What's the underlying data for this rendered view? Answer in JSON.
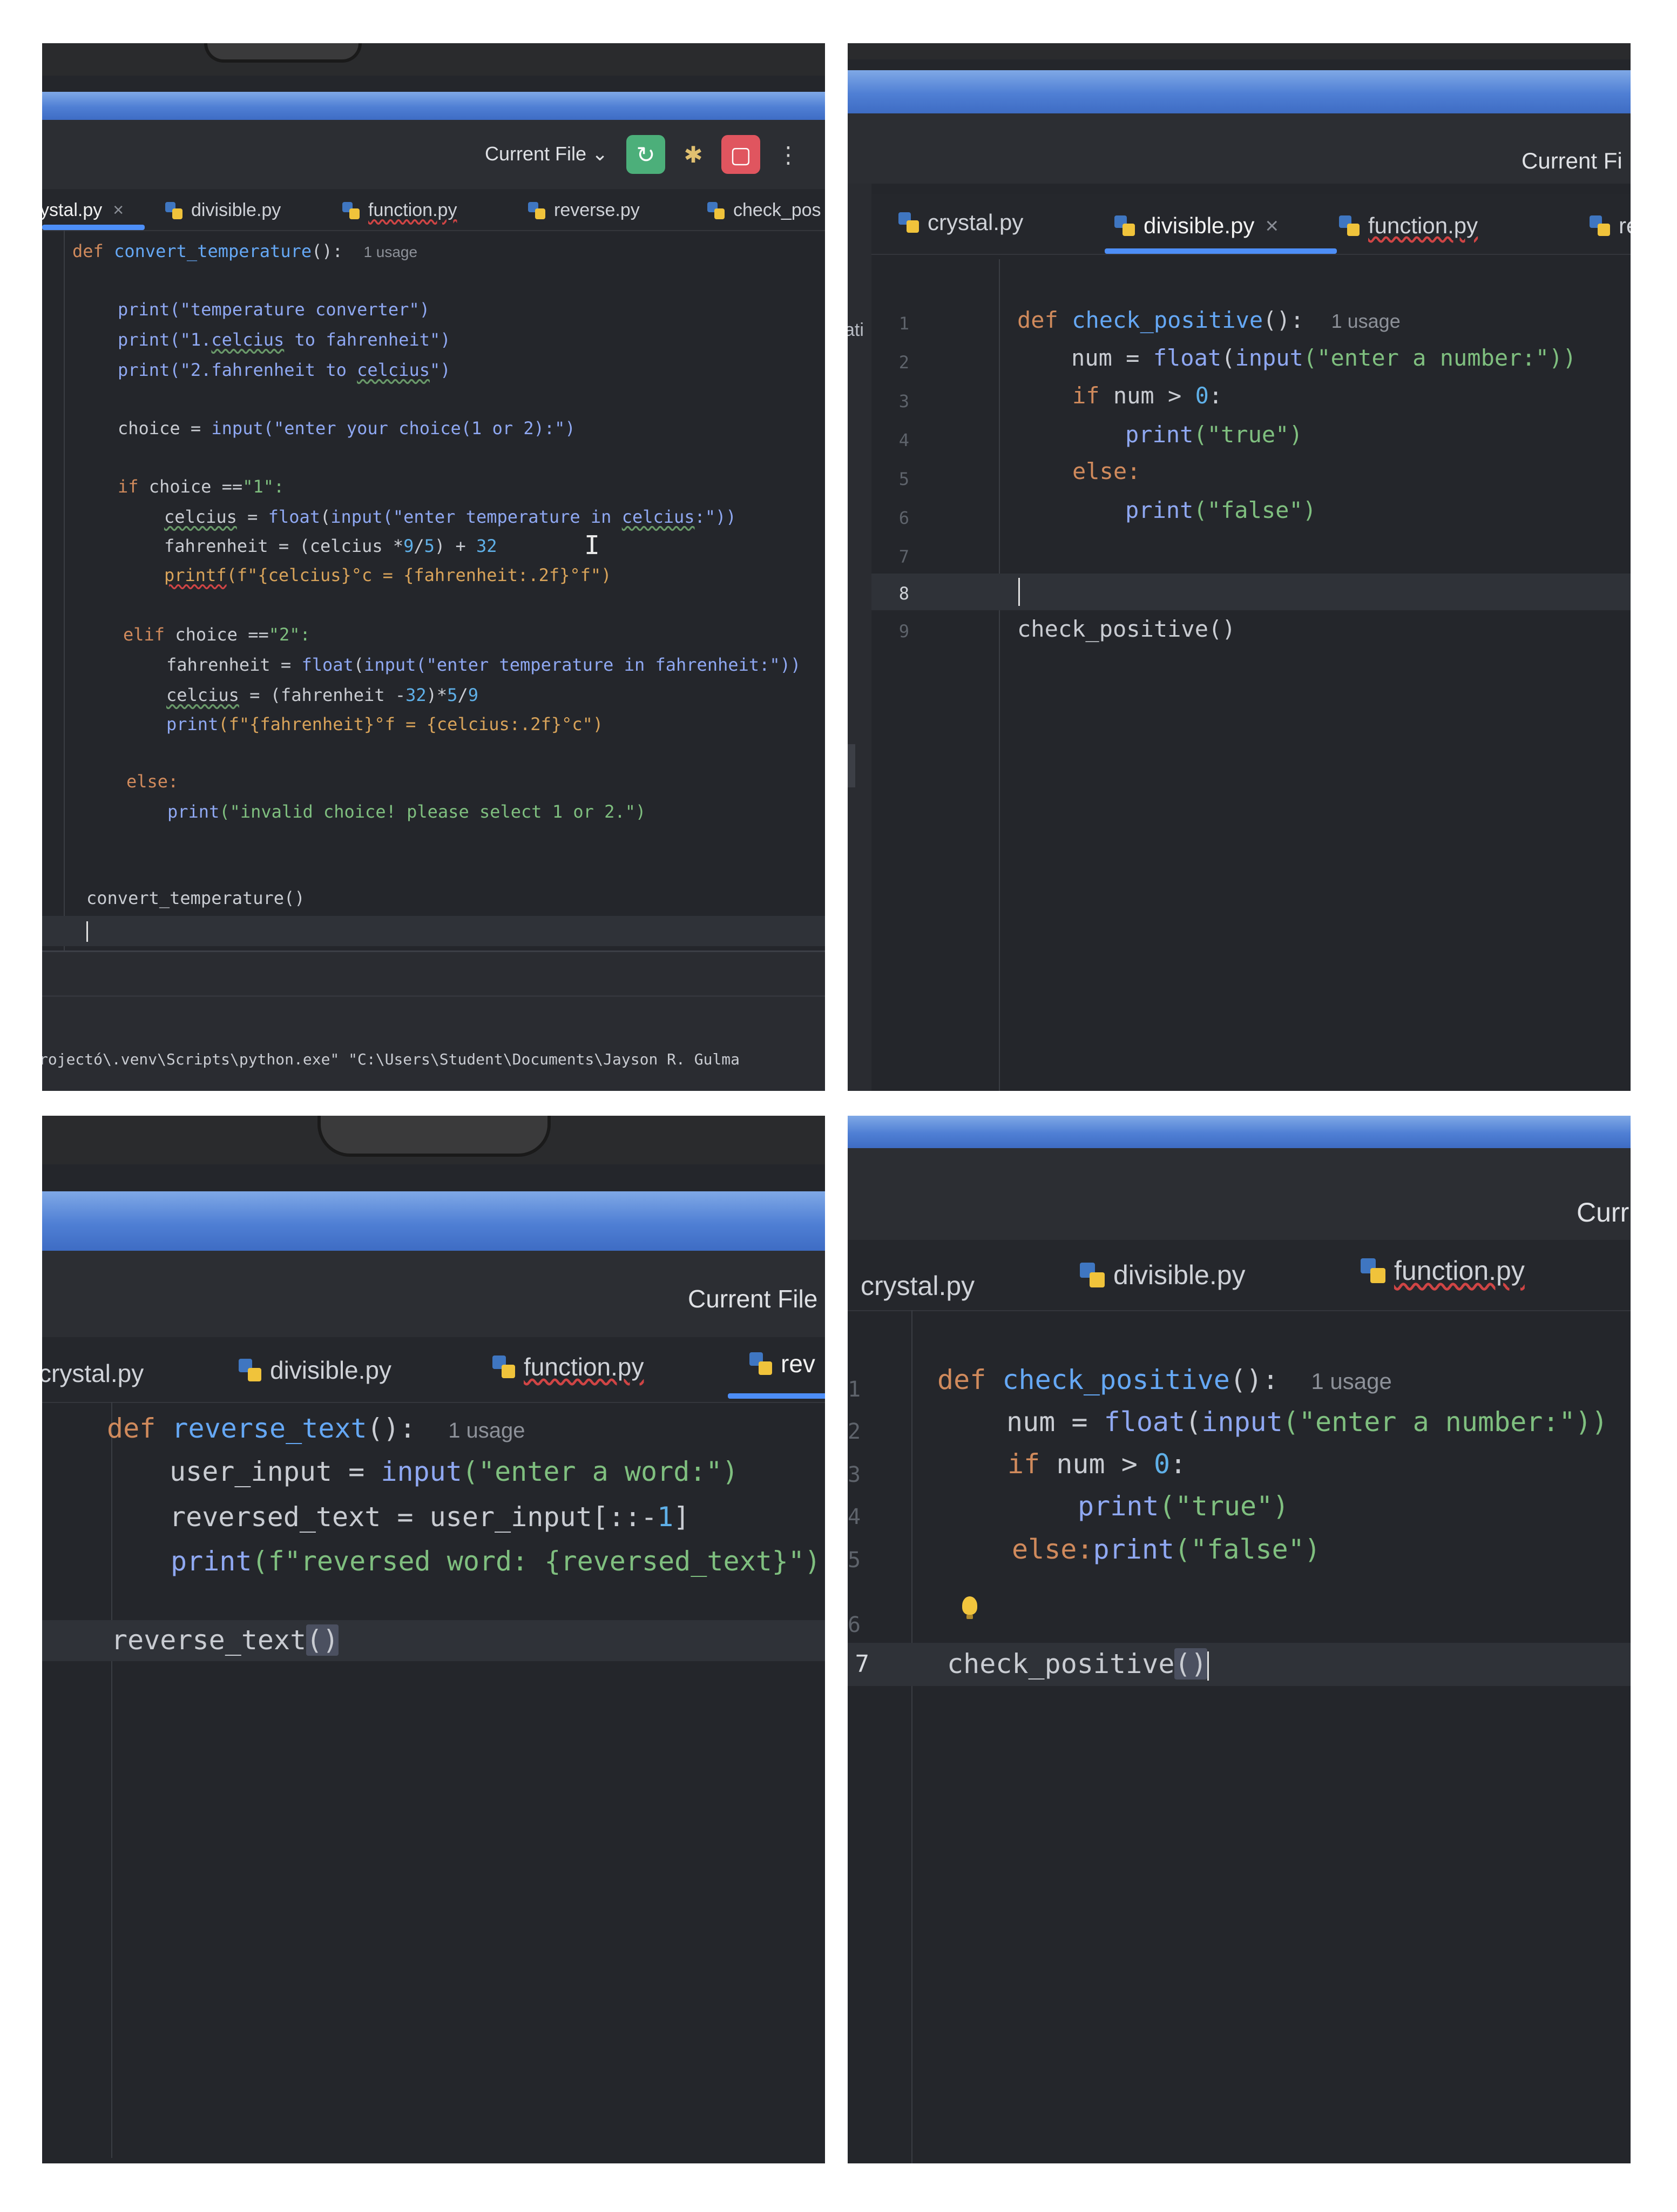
{
  "panel1": {
    "current_file": "Current File ⌄",
    "tabs": [
      "ystal.py",
      "divisible.py",
      "function.py",
      "reverse.py",
      "check_pos"
    ],
    "close_glyph": "×",
    "code": {
      "l1_def": "def",
      "l1_fn": "convert_temperature",
      "l1_paren": "():",
      "usage": "1 usage",
      "l2": "print(\"temperature converter\")",
      "l3_a": "print(\"1.",
      "l3_b": "celcius",
      "l3_c": " to fahrenheit\")",
      "l4_a": "print(\"2.fahrenheit to ",
      "l4_b": "celcius",
      "l4_c": "\")",
      "l5_a": "choice = ",
      "l5_b": "input",
      "l5_c": "(\"enter your choice(1 or 2):\")",
      "l6_a": "if",
      "l6_b": " choice ==",
      "l6_c": "\"1\":",
      "l7_a": "celcius",
      "l7_b": " = ",
      "l7_c": "float",
      "l7_d": "(",
      "l7_e": "input",
      "l7_f": "(\"enter temperature in ",
      "l7_g": "celcius",
      "l7_h": ":\"))",
      "l8_a": "fahrenheit = (celcius *",
      "l8_b": "9",
      "l8_c": "/",
      "l8_d": "5",
      "l8_e": ") + ",
      "l8_f": "32",
      "l9_a": "printf",
      "l9_b": "(f\"{celcius}°c = {fahrenheit:.2f}°f\")",
      "l10_a": "elif",
      "l10_b": " choice ==",
      "l10_c": "\"2\":",
      "l11_a": "fahrenheit = ",
      "l11_b": "float",
      "l11_c": "(",
      "l11_d": "input",
      "l11_e": "(\"enter temperature in fahrenheit:\"))",
      "l12_a": "celcius",
      "l12_b": " = (fahrenheit -",
      "l12_c": "32",
      "l12_d": ")*",
      "l12_e": "5",
      "l12_f": "/",
      "l12_g": "9",
      "l13_a": "print",
      "l13_b": "(f\"{fahrenheit}°f = {celcius:.2f}°c\")",
      "l14": "else:",
      "l15_a": "print",
      "l15_b": "(\"invalid choice! please select 1 or 2.\")",
      "l16": "convert_temperature()",
      "ibeam": "I"
    },
    "terminal": "rojectó\\.venv\\Scripts\\python.exe\" \"C:\\Users\\Student\\Documents\\Jayson R. Gulma"
  },
  "panel2": {
    "current_file": "Current Fi",
    "side_label": "ati",
    "tabs": [
      "crystal.py",
      "divisible.py",
      "function.py",
      "re"
    ],
    "close_glyph": "×",
    "line_numbers": [
      "1",
      "2",
      "3",
      "4",
      "5",
      "6",
      "7",
      "8",
      "9"
    ],
    "code": {
      "l1_def": "def",
      "l1_fn": "check_positive",
      "l1_paren": "():",
      "usage": "1 usage",
      "l2_a": "num = ",
      "l2_b": "float",
      "l2_c": "(",
      "l2_d": "input",
      "l2_e": "(\"enter a number:\"))",
      "l3_a": "if",
      "l3_b": " num > ",
      "l3_c": "0",
      "l3_d": ":",
      "l4_a": "print",
      "l4_b": "(\"true\")",
      "l5": "else:",
      "l6_a": "print",
      "l6_b": "(\"false\")",
      "l9": "check_positive()"
    }
  },
  "panel3": {
    "current_file": "Current File",
    "tabs": [
      "crystal.py",
      "divisible.py",
      "function.py",
      "rev"
    ],
    "code": {
      "l1_def": "def",
      "l1_fn": "reverse_text",
      "l1_paren": "():",
      "usage": "1 usage",
      "l2_a": "user_input = ",
      "l2_b": "input",
      "l2_c": "(\"enter a word:\")",
      "l3_a": "reversed_text = user_input[::-",
      "l3_b": "1",
      "l3_c": "]",
      "l4_a": "print",
      "l4_b": "(f\"reversed word: {reversed_text}\")",
      "l5_a": "reverse_text",
      "l5_b": "()"
    }
  },
  "panel4": {
    "current_file": "Curr",
    "tabs": [
      "crystal.py",
      "divisible.py",
      "function.py"
    ],
    "line_numbers": [
      "1",
      "2",
      "3",
      "4",
      "5",
      "6",
      "7"
    ],
    "code": {
      "l1_def": "def",
      "l1_fn": "check_positive",
      "l1_paren": "():",
      "usage": "1 usage",
      "l2_a": "num = ",
      "l2_b": "float",
      "l2_c": "(",
      "l2_d": "input",
      "l2_e": "(\"enter a number:\"))",
      "l3_a": "if",
      "l3_b": " num > ",
      "l3_c": "0",
      "l3_d": ":",
      "l4_a": "print",
      "l4_b": "(\"true\")",
      "l5_a": "else:",
      "l5_b": "print",
      "l5_c": "(\"false\")",
      "l7_a": "check_positive",
      "l7_b": "()"
    }
  },
  "colors": {
    "editor_bg": "#24262b",
    "keyword": "#d08a5c",
    "function": "#65a8f5",
    "string": "#7fbf7f",
    "number": "#5fb0e8",
    "tab_active_underline": "#4d8ef7",
    "run_button": "#4caf7a",
    "stop_button": "#e0555f"
  },
  "icons": [
    "python-file-icon",
    "run-icon",
    "debug-icon",
    "stop-icon",
    "more-icon",
    "lightbulb-icon"
  ]
}
